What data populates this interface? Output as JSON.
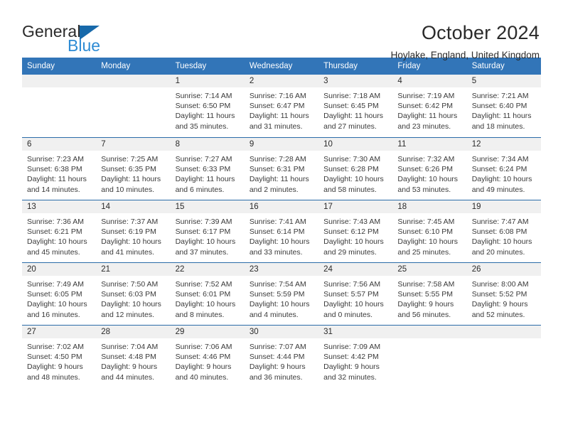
{
  "brand": {
    "line1": "General",
    "line2": "Blue",
    "triangle_color": "#1769aa",
    "line2_color": "#2d8bd4"
  },
  "header": {
    "title": "October 2024",
    "subtitle": "Hoylake, England, United Kingdom"
  },
  "theme": {
    "header_row_bg": "#3275b8",
    "week_divider": "#2b6ca8",
    "day_band_bg": "#f0f0f0",
    "text": "#2a2a2a"
  },
  "weekday_headers": [
    "Sunday",
    "Monday",
    "Tuesday",
    "Wednesday",
    "Thursday",
    "Friday",
    "Saturday"
  ],
  "weeks": [
    [
      {
        "day": "",
        "empty": true
      },
      {
        "day": "",
        "empty": true
      },
      {
        "day": "1",
        "sunrise": "Sunrise: 7:14 AM",
        "sunset": "Sunset: 6:50 PM",
        "daylight1": "Daylight: 11 hours",
        "daylight2": "and 35 minutes."
      },
      {
        "day": "2",
        "sunrise": "Sunrise: 7:16 AM",
        "sunset": "Sunset: 6:47 PM",
        "daylight1": "Daylight: 11 hours",
        "daylight2": "and 31 minutes."
      },
      {
        "day": "3",
        "sunrise": "Sunrise: 7:18 AM",
        "sunset": "Sunset: 6:45 PM",
        "daylight1": "Daylight: 11 hours",
        "daylight2": "and 27 minutes."
      },
      {
        "day": "4",
        "sunrise": "Sunrise: 7:19 AM",
        "sunset": "Sunset: 6:42 PM",
        "daylight1": "Daylight: 11 hours",
        "daylight2": "and 23 minutes."
      },
      {
        "day": "5",
        "sunrise": "Sunrise: 7:21 AM",
        "sunset": "Sunset: 6:40 PM",
        "daylight1": "Daylight: 11 hours",
        "daylight2": "and 18 minutes."
      }
    ],
    [
      {
        "day": "6",
        "sunrise": "Sunrise: 7:23 AM",
        "sunset": "Sunset: 6:38 PM",
        "daylight1": "Daylight: 11 hours",
        "daylight2": "and 14 minutes."
      },
      {
        "day": "7",
        "sunrise": "Sunrise: 7:25 AM",
        "sunset": "Sunset: 6:35 PM",
        "daylight1": "Daylight: 11 hours",
        "daylight2": "and 10 minutes."
      },
      {
        "day": "8",
        "sunrise": "Sunrise: 7:27 AM",
        "sunset": "Sunset: 6:33 PM",
        "daylight1": "Daylight: 11 hours",
        "daylight2": "and 6 minutes."
      },
      {
        "day": "9",
        "sunrise": "Sunrise: 7:28 AM",
        "sunset": "Sunset: 6:31 PM",
        "daylight1": "Daylight: 11 hours",
        "daylight2": "and 2 minutes."
      },
      {
        "day": "10",
        "sunrise": "Sunrise: 7:30 AM",
        "sunset": "Sunset: 6:28 PM",
        "daylight1": "Daylight: 10 hours",
        "daylight2": "and 58 minutes."
      },
      {
        "day": "11",
        "sunrise": "Sunrise: 7:32 AM",
        "sunset": "Sunset: 6:26 PM",
        "daylight1": "Daylight: 10 hours",
        "daylight2": "and 53 minutes."
      },
      {
        "day": "12",
        "sunrise": "Sunrise: 7:34 AM",
        "sunset": "Sunset: 6:24 PM",
        "daylight1": "Daylight: 10 hours",
        "daylight2": "and 49 minutes."
      }
    ],
    [
      {
        "day": "13",
        "sunrise": "Sunrise: 7:36 AM",
        "sunset": "Sunset: 6:21 PM",
        "daylight1": "Daylight: 10 hours",
        "daylight2": "and 45 minutes."
      },
      {
        "day": "14",
        "sunrise": "Sunrise: 7:37 AM",
        "sunset": "Sunset: 6:19 PM",
        "daylight1": "Daylight: 10 hours",
        "daylight2": "and 41 minutes."
      },
      {
        "day": "15",
        "sunrise": "Sunrise: 7:39 AM",
        "sunset": "Sunset: 6:17 PM",
        "daylight1": "Daylight: 10 hours",
        "daylight2": "and 37 minutes."
      },
      {
        "day": "16",
        "sunrise": "Sunrise: 7:41 AM",
        "sunset": "Sunset: 6:14 PM",
        "daylight1": "Daylight: 10 hours",
        "daylight2": "and 33 minutes."
      },
      {
        "day": "17",
        "sunrise": "Sunrise: 7:43 AM",
        "sunset": "Sunset: 6:12 PM",
        "daylight1": "Daylight: 10 hours",
        "daylight2": "and 29 minutes."
      },
      {
        "day": "18",
        "sunrise": "Sunrise: 7:45 AM",
        "sunset": "Sunset: 6:10 PM",
        "daylight1": "Daylight: 10 hours",
        "daylight2": "and 25 minutes."
      },
      {
        "day": "19",
        "sunrise": "Sunrise: 7:47 AM",
        "sunset": "Sunset: 6:08 PM",
        "daylight1": "Daylight: 10 hours",
        "daylight2": "and 20 minutes."
      }
    ],
    [
      {
        "day": "20",
        "sunrise": "Sunrise: 7:49 AM",
        "sunset": "Sunset: 6:05 PM",
        "daylight1": "Daylight: 10 hours",
        "daylight2": "and 16 minutes."
      },
      {
        "day": "21",
        "sunrise": "Sunrise: 7:50 AM",
        "sunset": "Sunset: 6:03 PM",
        "daylight1": "Daylight: 10 hours",
        "daylight2": "and 12 minutes."
      },
      {
        "day": "22",
        "sunrise": "Sunrise: 7:52 AM",
        "sunset": "Sunset: 6:01 PM",
        "daylight1": "Daylight: 10 hours",
        "daylight2": "and 8 minutes."
      },
      {
        "day": "23",
        "sunrise": "Sunrise: 7:54 AM",
        "sunset": "Sunset: 5:59 PM",
        "daylight1": "Daylight: 10 hours",
        "daylight2": "and 4 minutes."
      },
      {
        "day": "24",
        "sunrise": "Sunrise: 7:56 AM",
        "sunset": "Sunset: 5:57 PM",
        "daylight1": "Daylight: 10 hours",
        "daylight2": "and 0 minutes."
      },
      {
        "day": "25",
        "sunrise": "Sunrise: 7:58 AM",
        "sunset": "Sunset: 5:55 PM",
        "daylight1": "Daylight: 9 hours",
        "daylight2": "and 56 minutes."
      },
      {
        "day": "26",
        "sunrise": "Sunrise: 8:00 AM",
        "sunset": "Sunset: 5:52 PM",
        "daylight1": "Daylight: 9 hours",
        "daylight2": "and 52 minutes."
      }
    ],
    [
      {
        "day": "27",
        "sunrise": "Sunrise: 7:02 AM",
        "sunset": "Sunset: 4:50 PM",
        "daylight1": "Daylight: 9 hours",
        "daylight2": "and 48 minutes."
      },
      {
        "day": "28",
        "sunrise": "Sunrise: 7:04 AM",
        "sunset": "Sunset: 4:48 PM",
        "daylight1": "Daylight: 9 hours",
        "daylight2": "and 44 minutes."
      },
      {
        "day": "29",
        "sunrise": "Sunrise: 7:06 AM",
        "sunset": "Sunset: 4:46 PM",
        "daylight1": "Daylight: 9 hours",
        "daylight2": "and 40 minutes."
      },
      {
        "day": "30",
        "sunrise": "Sunrise: 7:07 AM",
        "sunset": "Sunset: 4:44 PM",
        "daylight1": "Daylight: 9 hours",
        "daylight2": "and 36 minutes."
      },
      {
        "day": "31",
        "sunrise": "Sunrise: 7:09 AM",
        "sunset": "Sunset: 4:42 PM",
        "daylight1": "Daylight: 9 hours",
        "daylight2": "and 32 minutes."
      },
      {
        "day": "",
        "empty": true
      },
      {
        "day": "",
        "empty": true
      }
    ]
  ]
}
